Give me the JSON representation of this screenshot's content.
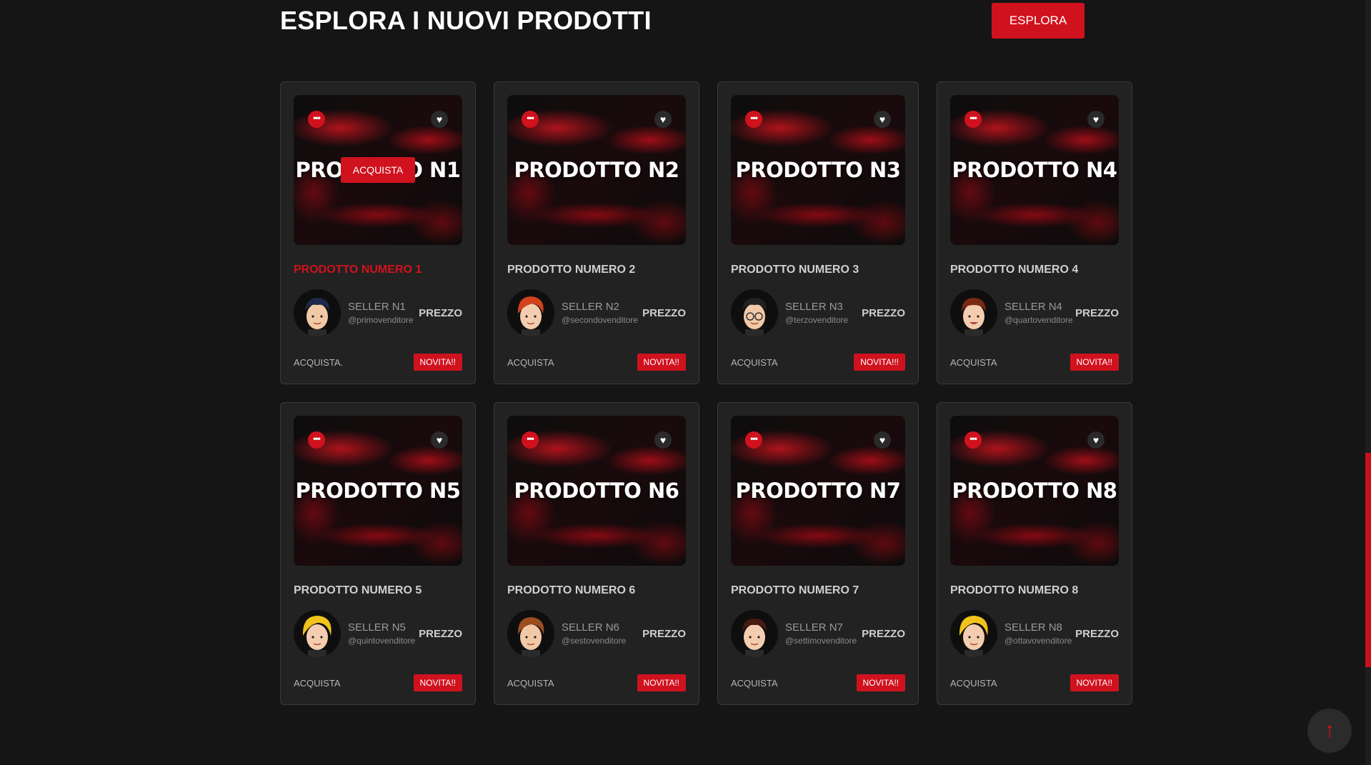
{
  "section": {
    "title": "ESPLORA I NUOVI PRODOTTI",
    "explore_label": "ESPLORA"
  },
  "colors": {
    "accent": "#d0121e",
    "background": "#151515",
    "card": "#222222"
  },
  "icons": {
    "more": "more-dots-icon",
    "favorite": "heart-icon",
    "scroll_top": "arrow-up-icon"
  },
  "products": [
    {
      "thumb_label": "PRODOTTO N1",
      "overlay_label": "ACQUISTA",
      "title": "PRODOTTO NUMERO 1",
      "seller": "SELLER N1",
      "handle": "@primovenditore",
      "price": "PREZZO",
      "buy": "ACQUISTA.",
      "badge": "NOVITA!!"
    },
    {
      "thumb_label": "PRODOTTO N2",
      "title": "PRODOTTO NUMERO 2",
      "seller": "SELLER N2",
      "handle": "@secondovenditore",
      "price": "PREZZO",
      "buy": "ACQUISTA",
      "badge": "NOVITA!!"
    },
    {
      "thumb_label": "PRODOTTO N3",
      "title": "PRODOTTO NUMERO 3",
      "seller": "SELLER N3",
      "handle": "@terzovenditore",
      "price": "PREZZO",
      "buy": "ACQUISTA",
      "badge": "NOVITA!!!"
    },
    {
      "thumb_label": "PRODOTTO N4",
      "title": "PRODOTTO NUMERO 4",
      "seller": "SELLER N4",
      "handle": "@quartovenditore",
      "price": "PREZZO",
      "buy": "ACQUISTA",
      "badge": "NOVITA!!"
    },
    {
      "thumb_label": "PRODOTTO N5",
      "title": "PRODOTTO NUMERO 5",
      "seller": "SELLER N5",
      "handle": "@quintovenditore",
      "price": "PREZZO",
      "buy": "ACQUISTA",
      "badge": "NOVITA!!"
    },
    {
      "thumb_label": "PRODOTTO N6",
      "title": "PRODOTTO NUMERO 6",
      "seller": "SELLER N6",
      "handle": "@sestovenditore",
      "price": "PREZZO",
      "buy": "ACQUISTA",
      "badge": "NOVITA!!"
    },
    {
      "thumb_label": "PRODOTTO N7",
      "title": "PRODOTTO NUMERO 7",
      "seller": "SELLER N7",
      "handle": "@settimovenditore",
      "price": "PREZZO",
      "buy": "ACQUISTA",
      "badge": "NOVITA!!"
    },
    {
      "thumb_label": "PRODOTTO N8",
      "title": "PRODOTTO NUMERO 8",
      "seller": "SELLER N8",
      "handle": "@ottavovenditore",
      "price": "PREZZO",
      "buy": "ACQUISTA",
      "badge": "NOVITA!!"
    }
  ]
}
